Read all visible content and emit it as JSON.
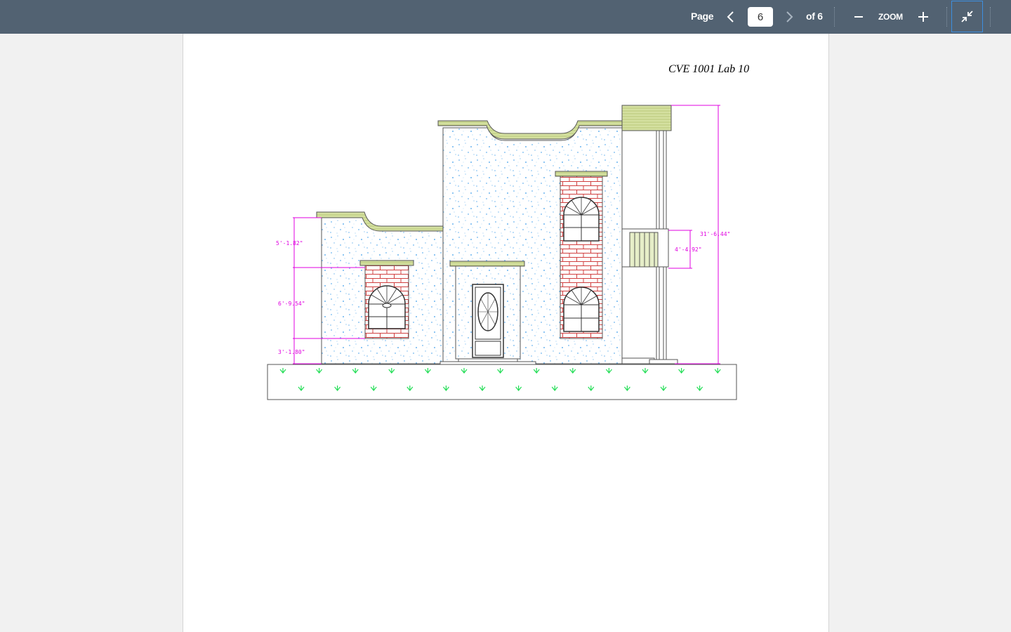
{
  "toolbar": {
    "page_label": "Page",
    "current_page": "6",
    "of_label": "of 6",
    "zoom_label": "ZOOM",
    "prev_icon": "chevron-left-icon",
    "next_icon": "chevron-right-icon",
    "zoom_out_icon": "minus-icon",
    "zoom_in_icon": "plus-icon",
    "collapse_icon": "collapse-arrows-icon",
    "background_color": "#526272"
  },
  "document": {
    "title": "CVE 1001 Lab 10",
    "drawing": {
      "dimensions": [
        "5'-1.82\"",
        "6'-9.54\"",
        "3'-1.80\"",
        "31'-6.44\"",
        "4'-4.92\""
      ],
      "colors": {
        "dimension": "#e000e0",
        "brick": "#d04040",
        "stucco_dots": "#6ab4f0",
        "cap": "#c8d890",
        "grass": "#22dd55"
      }
    }
  }
}
